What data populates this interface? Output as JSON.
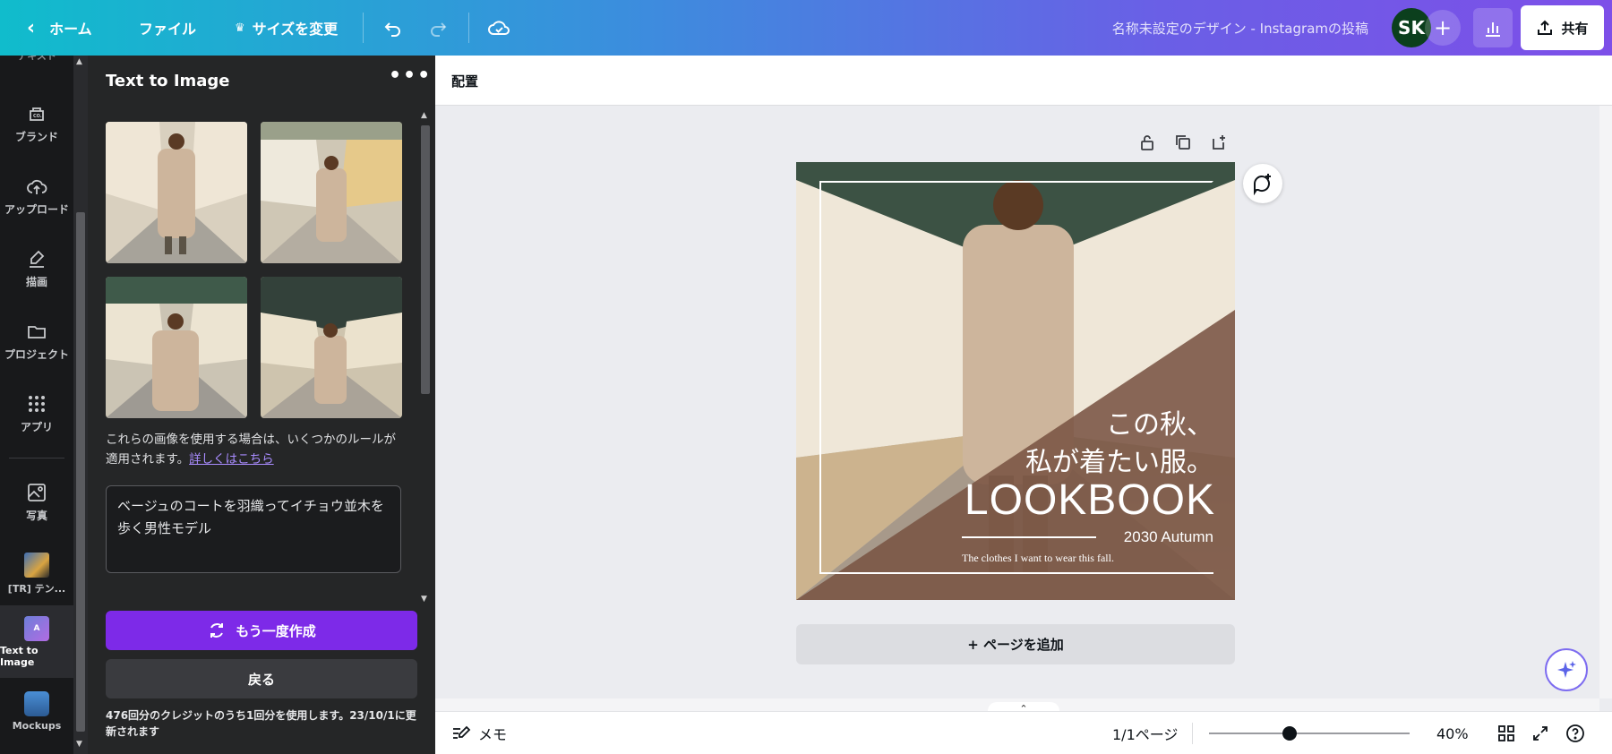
{
  "topbar": {
    "home": "ホーム",
    "file": "ファイル",
    "resize": "サイズを変更",
    "title": "名称未設定のデザイン - Instagramの投稿",
    "avatar": "SK",
    "share": "共有"
  },
  "rail": {
    "cut_label": "テキスト",
    "items": [
      {
        "label": "ブランド",
        "icon": "brand-icon"
      },
      {
        "label": "アップロード",
        "icon": "upload-cloud-icon"
      },
      {
        "label": "描画",
        "icon": "draw-icon"
      },
      {
        "label": "プロジェクト",
        "icon": "folder-icon"
      },
      {
        "label": "アプリ",
        "icon": "apps-grid-icon"
      },
      {
        "label": "写真",
        "icon": "photo-icon"
      },
      {
        "label": "[TR] テン...",
        "icon": "app-thumbnail-icon"
      },
      {
        "label": "Text to Image",
        "icon": "text-to-image-icon"
      },
      {
        "label": "Mockups",
        "icon": "mockups-icon"
      }
    ]
  },
  "panel": {
    "title": "Text to Image",
    "more": "•••",
    "note": "これらの画像を使用する場合は、いくつかのルールが適用されます。",
    "note_link": "詳しくはこちら",
    "prompt": "ベージュのコートを羽織ってイチョウ並木を歩く男性モデル",
    "regenerate": "もう一度作成",
    "back": "戻る",
    "credit_note": "476回分のクレジットのうち1回分を使用します。23/10/1に更新されます"
  },
  "editor": {
    "arrange": "配置",
    "add_page": "+ ページを追加"
  },
  "design": {
    "line1": "この秋、",
    "line2": "私が着たい服。",
    "headline": "LOOKBOOK",
    "season": "2030 Autumn",
    "tagline": "The clothes I want to wear this fall."
  },
  "bottombar": {
    "notes": "メモ",
    "pages": "1/1ページ",
    "zoom": "40%",
    "zoom_value": 0.4
  },
  "colors": {
    "accent": "#7d2ae8",
    "avatar_bg": "#0b3f1d",
    "coat": "#cdb59c"
  }
}
